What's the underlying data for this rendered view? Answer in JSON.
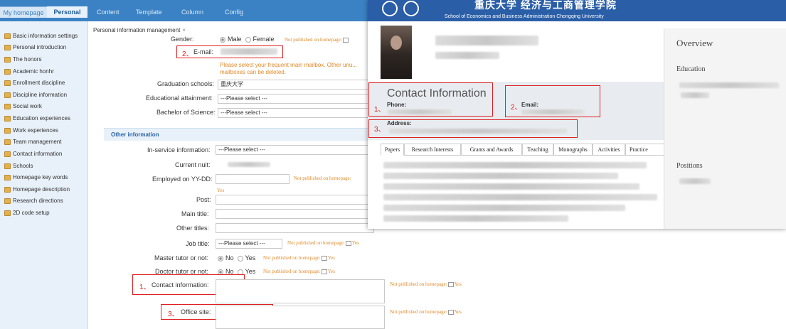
{
  "topbar": {
    "tabs": [
      "My homepage",
      "Personal",
      "Content",
      "Template",
      "Column",
      "Config"
    ]
  },
  "sidebar": {
    "items": [
      "Basic information settings",
      "Personal introduction",
      "The honors",
      "Academic honhr",
      "Enrollment discipline",
      "Discipline information",
      "Social work",
      "Education experiences",
      "Work experiences",
      "Team management",
      "Contact information",
      "Schools",
      "Homepage key words",
      "Homepage description",
      "Research directions",
      "2D code setup"
    ]
  },
  "form": {
    "breadcrumb": "Personal information management",
    "close_glyph": "×",
    "gender_label": "Gender:",
    "gender_options": [
      "Male",
      "Female"
    ],
    "not_published": "Not published on homepage:",
    "yes": "Yes",
    "email_label": "E-mail:",
    "email_num": "2、",
    "email_hint": "Please select your frequent main mailbox. Other unu... mailboxes can be deleted.",
    "graduation_label": "Graduation schools:",
    "graduation_value": "重庆大学",
    "attainment_label": "Educational attainment:",
    "attainment_value": "---Please select ---",
    "bachelor_label": "Bachelor of Science:",
    "bachelor_value": "---Please select ---",
    "other_info_section": "Other information",
    "inservice_label": "In-service information:",
    "inservice_value": "---Please select ---",
    "current_unit_label": "Current nuit:",
    "employed_label": "Employed on YY-DD:",
    "post_label": "Post:",
    "main_title_label": "Main title:",
    "other_titles_label": "Other titles:",
    "job_title_label": "Job title:",
    "job_title_value": "---Please select ---",
    "master_label": "Master tutor or not:",
    "doctor_label": "Doctor tutor or not:",
    "no_yes": [
      "No",
      "Yes"
    ],
    "contact_info_label": "Contact information:",
    "contact_num": "1、",
    "office_label": "Office site:",
    "office_num": "3、"
  },
  "overlay": {
    "school_subtitle": "School of Economics and Business Administration Chongqing University",
    "school_title_partial": "重庆大学  经济与工商管理学院",
    "contact_title": "Contact Information",
    "phone_label": "Phone:",
    "phone_num": "1、",
    "email_label": "Email:",
    "email_num": "2、",
    "address_label": "Address:",
    "address_num": "3、",
    "tabs": [
      "Papers",
      "Research Interests",
      "Grants and Awards",
      "Teaching",
      "Monographs",
      "Activities",
      "Practice"
    ],
    "overview": "Overview",
    "education": "Education",
    "positions": "Positions"
  },
  "colors": {
    "topbar": "#3b82c4",
    "sidebar_bg": "#e8f1f9",
    "annotation_red": "#e02020",
    "hint_orange": "#e08a2a",
    "overlay_header": "#2a5ea7"
  }
}
